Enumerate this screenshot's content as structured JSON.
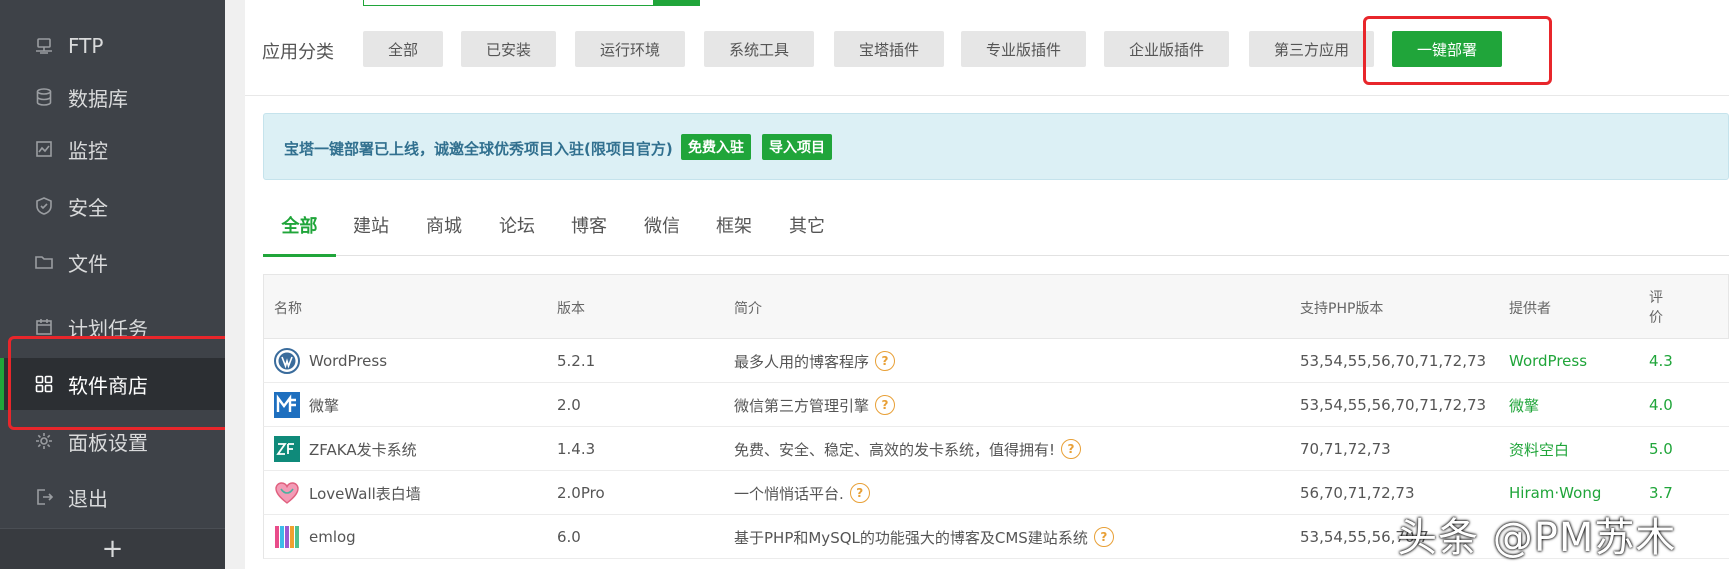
{
  "sidebar": {
    "items": [
      {
        "label": "FTP",
        "icon": "ftp-icon"
      },
      {
        "label": "数据库",
        "icon": "database-icon"
      },
      {
        "label": "监控",
        "icon": "monitor-icon"
      },
      {
        "label": "安全",
        "icon": "shield-icon"
      },
      {
        "label": "文件",
        "icon": "folder-icon"
      },
      {
        "label": "计划任务",
        "icon": "calendar-icon"
      },
      {
        "label": "软件商店",
        "icon": "grid-icon"
      },
      {
        "label": "面板设置",
        "icon": "gear-icon"
      },
      {
        "label": "退出",
        "icon": "logout-icon"
      }
    ],
    "add_label": "+"
  },
  "categories": {
    "label": "应用分类",
    "buttons": [
      "全部",
      "已安装",
      "运行环境",
      "系统工具",
      "宝塔插件",
      "专业版插件",
      "企业版插件",
      "第三方应用",
      "一键部署"
    ]
  },
  "notice": {
    "text": "宝塔一键部署已上线，诚邀全球优秀项目入驻(限项目官方)",
    "btn_join": "免费入驻",
    "btn_import": "导入项目"
  },
  "tabs": [
    "全部",
    "建站",
    "商城",
    "论坛",
    "博客",
    "微信",
    "框架",
    "其它"
  ],
  "table": {
    "headers": {
      "name": "名称",
      "version": "版本",
      "desc": "简介",
      "php": "支持PHP版本",
      "provider": "提供者",
      "rating_1": "评",
      "rating_2": "价"
    },
    "rows": [
      {
        "name": "WordPress",
        "version": "5.2.1",
        "desc": "最多人用的博客程序",
        "php": "53,54,55,56,70,71,72,73",
        "provider": "WordPress",
        "rating": "4.3",
        "icon": "wordpress-icon"
      },
      {
        "name": "微擎",
        "version": "2.0",
        "desc": "微信第三方管理引擎",
        "php": "53,54,55,56,70,71,72,73",
        "provider": "微擎",
        "rating": "4.0",
        "icon": "weiqing-icon"
      },
      {
        "name": "ZFAKA发卡系统",
        "version": "1.4.3",
        "desc": "免费、安全、稳定、高效的发卡系统，值得拥有!",
        "php": "70,71,72,73",
        "provider": "资料空白",
        "rating": "5.0",
        "icon": "zfaka-icon"
      },
      {
        "name": "LoveWall表白墙",
        "version": "2.0Pro",
        "desc": "一个悄悄话平台.",
        "php": "56,70,71,72,73",
        "provider": "Hiram·Wong",
        "rating": "3.7",
        "icon": "lovewall-icon"
      },
      {
        "name": "emlog",
        "version": "6.0",
        "desc": "基于PHP和MySQL的功能强大的博客及CMS建站系统",
        "php": "53,54,55,56,70,7",
        "provider": "",
        "rating": "",
        "icon": "emlog-icon"
      }
    ],
    "help_glyph": "?"
  },
  "watermark": "头条 @PM苏木",
  "colors": {
    "accent": "#20a53a",
    "sidebar": "#3e4248",
    "highlight": "#e8262b"
  }
}
